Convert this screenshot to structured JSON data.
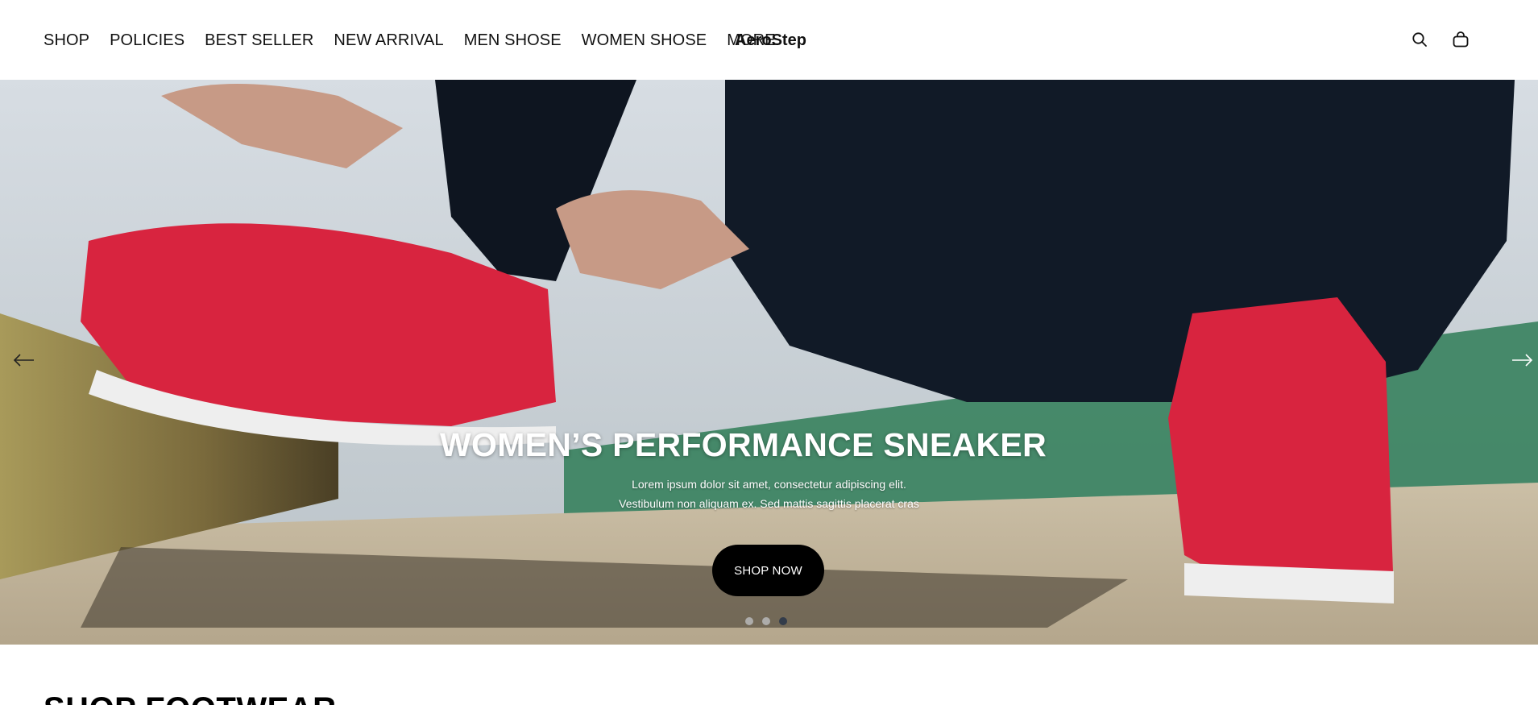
{
  "header": {
    "nav": [
      "SHOP",
      "POLICIES",
      "BEST SELLER",
      "NEW ARRIVAL",
      "MEN SHOSE",
      "WOMEN SHOSE",
      "MORE"
    ],
    "brand": "AeroStep",
    "icons": [
      "search-icon",
      "shopping-bag-icon"
    ]
  },
  "hero": {
    "title": "WOMEN’S PERFORMANCE SNEAKER",
    "subtitle_line1": "Lorem ipsum dolor sit amet, consectetur adipiscing elit.",
    "subtitle_line2": "Vestibulum non aliquam ex. Sed mattis sagittis placerat cras",
    "cta_label": "SHOP NOW",
    "slides_count": 3,
    "active_slide": 3,
    "colors": {
      "cta_bg": "#000000",
      "cta_text": "#ffffff",
      "dot_active": "#333c4a",
      "dot_inactive": "#b4b4b4"
    }
  },
  "section": {
    "title": "SHOP FOOTWEAR"
  }
}
